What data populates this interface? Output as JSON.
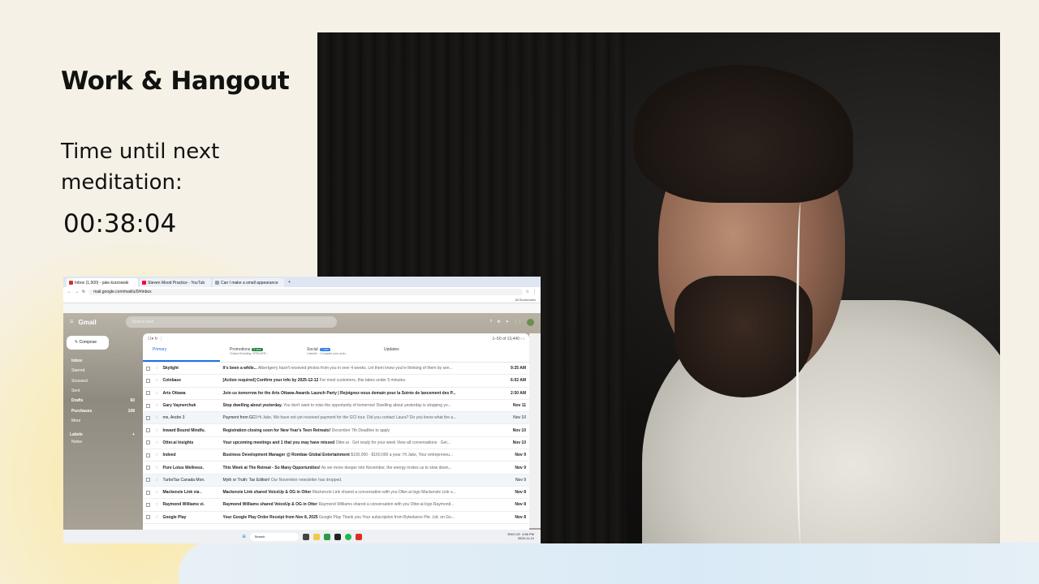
{
  "slide": {
    "title": "Work & Hangout",
    "timer_label": "Time until next meditation:",
    "timer_value": "00:38:04"
  },
  "browser": {
    "tabs": [
      {
        "label": "Inbox (1,500) - jake.kurzowski",
        "icon": "gmail-icon",
        "active": true
      },
      {
        "label": "Steven Mood Practice - YouTub",
        "icon": "youtube-icon",
        "active": false
      },
      {
        "label": "Can I make a small appearance",
        "icon": "doc-icon",
        "active": false
      }
    ],
    "url": "mail.google.com/mail/u/0/#inbox",
    "bookmarks_label": "All Bookmarks"
  },
  "gmail": {
    "logo": "Gmail",
    "search_placeholder": "Search mail",
    "compose_label": "Compose",
    "nav": [
      {
        "label": "Inbox",
        "count": "",
        "bold": true
      },
      {
        "label": "Starred",
        "count": "",
        "bold": false
      },
      {
        "label": "Snoozed",
        "count": "",
        "bold": false
      },
      {
        "label": "Sent",
        "count": "",
        "bold": false
      },
      {
        "label": "Drafts",
        "count": "60",
        "bold": true
      },
      {
        "label": "Purchases",
        "count": "108",
        "bold": true
      },
      {
        "label": "More",
        "count": "",
        "bold": false
      }
    ],
    "labels_header": "Labels",
    "labels": [
      "Notes"
    ],
    "page_range": "1–50 of 13,440",
    "tabs": [
      {
        "label": "Primary",
        "badge": "",
        "sub": ""
      },
      {
        "label": "Promotions",
        "badge": "9 new",
        "sub": "Chakra Branding, SPEKAFR..."
      },
      {
        "label": "Social",
        "badge": "1 new",
        "sub": "LinkedIn - Complete your actio..."
      },
      {
        "label": "Updates",
        "badge": "",
        "sub": ""
      }
    ],
    "emails": [
      {
        "sender": "Skylight",
        "subject": "It's been a while...",
        "snippet": "Albertgerry hasn't received photos from you in over 4 weeks. Let them know you're thinking of them by sen...",
        "date": "9:25 AM",
        "read": false
      },
      {
        "sender": "Coinbase",
        "subject": "[Action required] Confirm your info by 2025-12-12",
        "snippet": "For most customers, this takes under 5 minutes.",
        "date": "6:02 AM",
        "read": false
      },
      {
        "sender": "Arts Ottawa",
        "subject": "Join us tomorrow for the Arts Ottawa Awards Launch Party | Rejoignez-nous demain pour la Soirée de lancement des P...",
        "snippet": "",
        "date": "2:50 AM",
        "read": false
      },
      {
        "sender": "Gary Vaynerchuk",
        "subject": "Stop dwelling about yesterday.",
        "snippet": "You don't want to miss the opportunity of tomorrow! Dwelling about yesterday is stopping yo...",
        "date": "Nov 11",
        "read": false
      },
      {
        "sender": "me, Andre 3",
        "subject": "Payment from GCI",
        "snippet": "Hi Jake, We have not yet received payment for the GCI tour. Did you contact Laura? Do you know what the a...",
        "date": "Nov 10",
        "read": true
      },
      {
        "sender": "Inward Bound Mindfu.",
        "subject": "Registration closing soon for New Year's Teen Retreats!",
        "snippet": "December 7th Deadline to apply",
        "date": "Nov 10",
        "read": false
      },
      {
        "sender": "Otter.ai Insights",
        "subject": "Your upcoming meetings and 1 that you may have missed",
        "snippet": "Otter.ai · Get ready for your week View all conversations · Get...",
        "date": "Nov 10",
        "read": false
      },
      {
        "sender": "Indeed",
        "subject": "Business Development Manager @ Rombae Global Entertainment",
        "snippet": "$100,000 - $160,000 a year. Hi Jake, Your entrepreneu...",
        "date": "Nov 9",
        "read": false
      },
      {
        "sender": "Pure Lotus Wellness.",
        "subject": "This Week at The Retreat - So Many Opportunities!",
        "snippet": "As we move deeper into November, the energy invites us to slow down...",
        "date": "Nov 9",
        "read": false
      },
      {
        "sender": "TurboTax Canada Mon.",
        "subject": "Myth or Truth: Tax Edition!",
        "snippet": "Our November newsletter has dropped.",
        "date": "Nov 9",
        "read": true
      },
      {
        "sender": "Mackenzie Link via .",
        "subject": "Mackenzie Link shared VoiceUp & OG in Otter",
        "snippet": "Mackenzie Link shared a conversation with you Otter.ai logo Mackenzie Link s...",
        "date": "Nov 8",
        "read": false
      },
      {
        "sender": "Raymond Williams vi.",
        "subject": "Raymond Williams shared VoiceUp & OG in Otter",
        "snippet": "Raymond Williams shared a conversation with you Otter.ai logo Raymond...",
        "date": "Nov 8",
        "read": false
      },
      {
        "sender": "Google Play",
        "subject": "Your Google Play Order Receipt from Nov 8, 2025",
        "snippet": "Google Play Thank you Your subscription from Bytedance Pte. Ltd. on Go...",
        "date": "Nov 8",
        "read": false
      }
    ]
  },
  "taskbar": {
    "search_label": "Search",
    "lang": "ENG US",
    "time": "4:56 PM",
    "date": "2025-11-12"
  },
  "colors": {
    "accent_blue": "#1a73e8",
    "promotions_badge": "#188038",
    "social_badge": "#1a73e8"
  }
}
